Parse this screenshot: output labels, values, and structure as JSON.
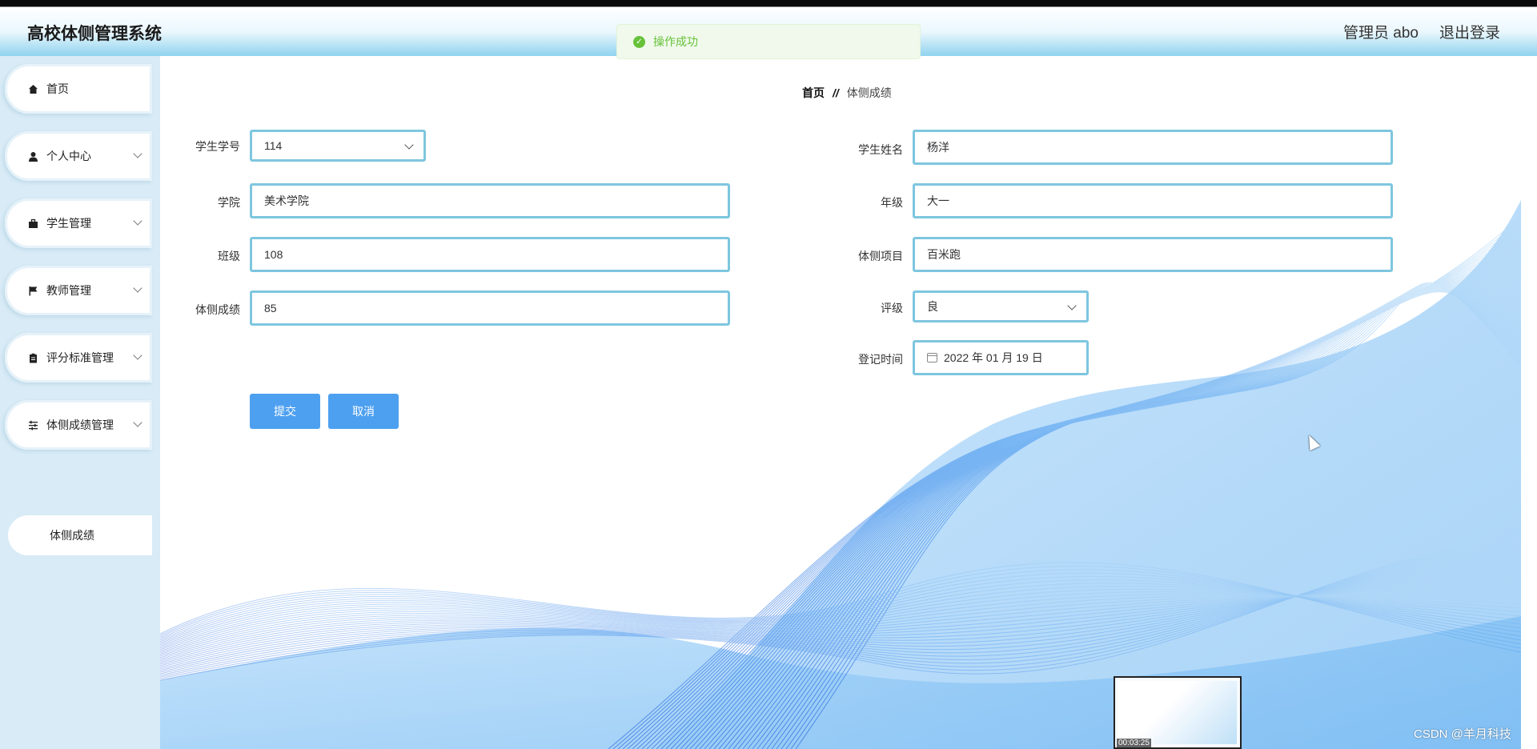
{
  "header": {
    "app_title": "高校体侧管理系统",
    "user_label": "管理员 abo",
    "logout_label": "退出登录"
  },
  "toast": {
    "message": "操作成功",
    "status_color": "#67c23a"
  },
  "sidebar": {
    "items": [
      {
        "label": "首页",
        "icon": "home-icon"
      },
      {
        "label": "个人中心",
        "icon": "user-icon"
      },
      {
        "label": "学生管理",
        "icon": "briefcase-icon"
      },
      {
        "label": "教师管理",
        "icon": "flag-icon"
      },
      {
        "label": "评分标准管理",
        "icon": "clipboard-icon"
      },
      {
        "label": "体侧成绩管理",
        "icon": "sliders-icon"
      }
    ],
    "subitem": "体侧成绩"
  },
  "breadcrumb": {
    "home": "首页",
    "separator": "//",
    "current": "体侧成绩"
  },
  "form": {
    "student_no": {
      "label": "学生学号",
      "value": "114"
    },
    "student_name": {
      "label": "学生姓名",
      "value": "杨洋"
    },
    "college": {
      "label": "学院",
      "value": "美术学院"
    },
    "grade": {
      "label": "年级",
      "value": "大一"
    },
    "class": {
      "label": "班级",
      "value": "108"
    },
    "test_item": {
      "label": "体侧项目",
      "value": "百米跑"
    },
    "score": {
      "label": "体侧成绩",
      "value": "85"
    },
    "rating": {
      "label": "评级",
      "value": "良"
    },
    "register_time": {
      "label": "登记时间",
      "value": "2022 年 01 月 19 日"
    }
  },
  "buttons": {
    "submit": "提交",
    "cancel": "取消",
    "color": "#4da0f0"
  },
  "overlay": {
    "video_time": "00:03:25",
    "watermark": "CSDN @羊月科技"
  }
}
